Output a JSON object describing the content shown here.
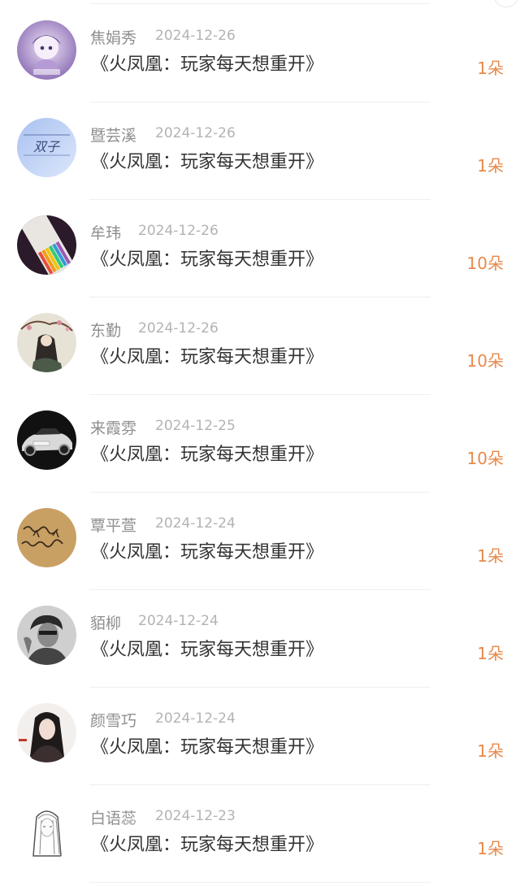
{
  "colors": {
    "amount": "#e8894a",
    "name": "#8e8e8e",
    "date": "#b3b3b3",
    "title": "#333333"
  },
  "records": [
    {
      "name": "焦娟秀",
      "date": "2024-12-26",
      "title": "《火凤凰：玩家每天想重开》",
      "amount": "1朵",
      "avatar_icon": "anime-girl-avatar-icon"
    },
    {
      "name": "暨芸溪",
      "date": "2024-12-26",
      "title": "《火凤凰：玩家每天想重开》",
      "amount": "1朵",
      "avatar_icon": "text-art-avatar-icon",
      "avatar_text": "双子"
    },
    {
      "name": "牟玮",
      "date": "2024-12-26",
      "title": "《火凤凰：玩家每天想重开》",
      "amount": "10朵",
      "avatar_icon": "pencils-avatar-icon"
    },
    {
      "name": "东勤",
      "date": "2024-12-26",
      "title": "《火凤凰：玩家每天想重开》",
      "amount": "10朵",
      "avatar_icon": "painting-avatar-icon"
    },
    {
      "name": "来霞雰",
      "date": "2024-12-25",
      "title": "《火凤凰：玩家每天想重开》",
      "amount": "10朵",
      "avatar_icon": "car-avatar-icon"
    },
    {
      "name": "覃平萱",
      "date": "2024-12-24",
      "title": "《火凤凰：玩家每天想重开》",
      "amount": "1朵",
      "avatar_icon": "handwriting-avatar-icon"
    },
    {
      "name": "貊柳",
      "date": "2024-12-24",
      "title": "《火凤凰：玩家每天想重开》",
      "amount": "1朵",
      "avatar_icon": "man-portrait-avatar-icon"
    },
    {
      "name": "颜雪巧",
      "date": "2024-12-24",
      "title": "《火凤凰：玩家每天想重开》",
      "amount": "1朵",
      "avatar_icon": "woman-portrait-avatar-icon"
    },
    {
      "name": "白语蕊",
      "date": "2024-12-23",
      "title": "《火凤凰：玩家每天想重开》",
      "amount": "1朵",
      "avatar_icon": "sketch-girl-avatar-icon"
    }
  ]
}
